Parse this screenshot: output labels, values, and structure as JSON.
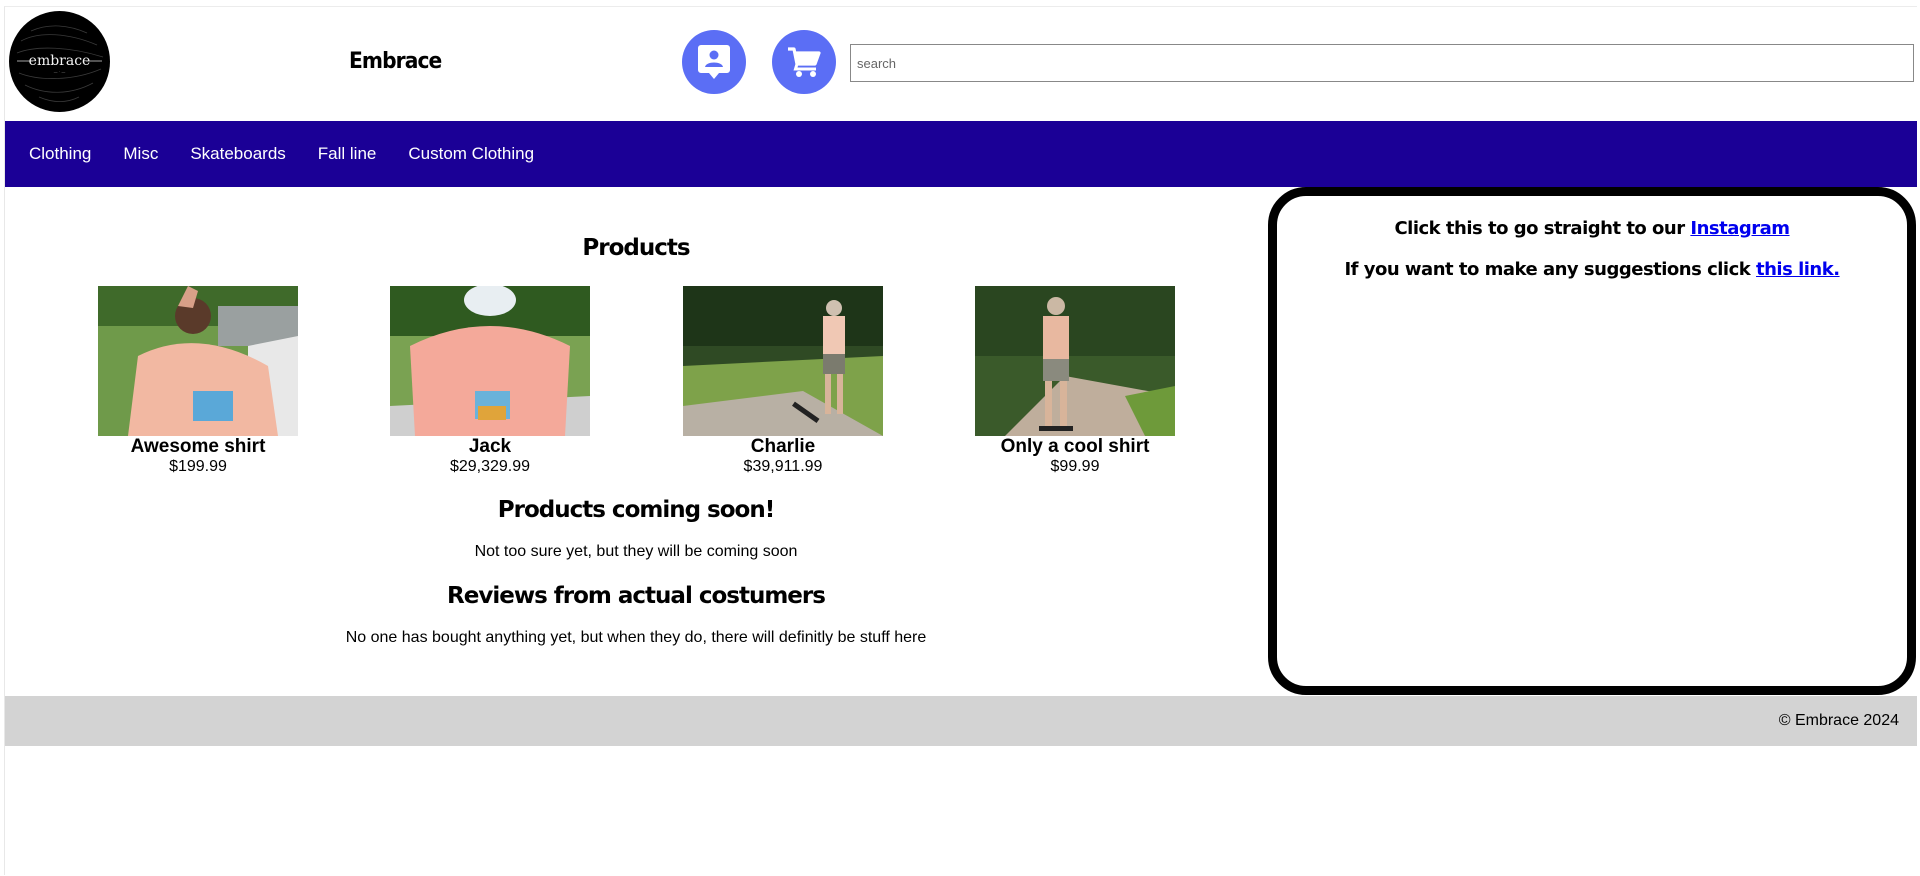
{
  "header": {
    "logo_text": "embrace",
    "brand": "Embrace",
    "account_icon": "account-box-icon",
    "cart_icon": "shopping-cart-icon",
    "search_placeholder": "search"
  },
  "nav": {
    "items": [
      {
        "label": "Clothing"
      },
      {
        "label": "Misc"
      },
      {
        "label": "Skateboards"
      },
      {
        "label": "Fall line"
      },
      {
        "label": "Custom Clothing"
      }
    ]
  },
  "main": {
    "products_title": "Products",
    "products": [
      {
        "name": "Awesome shirt",
        "price": "$199.99"
      },
      {
        "name": "Jack",
        "price": "$29,329.99"
      },
      {
        "name": "Charlie",
        "price": "$39,911.99"
      },
      {
        "name": "Only a cool shirt",
        "price": "$99.99"
      }
    ],
    "coming_soon_title": "Products coming soon!",
    "coming_soon_text": "Not too sure yet, but they will be coming soon",
    "reviews_title": "Reviews from actual costumers",
    "reviews_text": "No one has bought anything yet, but when they do, there will definitly be stuff here"
  },
  "aside": {
    "instagram_prefix": "Click this to go straight to our ",
    "instagram_link": "Instagram",
    "suggest_prefix": "If you want to make any suggestions click ",
    "suggest_link": "this link."
  },
  "footer": {
    "copyright": "© Embrace 2024"
  },
  "colors": {
    "nav_bg": "#1b0096",
    "icon_button": "#5b6ef5",
    "link": "#0000ee",
    "footer_bg": "#d3d3d3"
  }
}
